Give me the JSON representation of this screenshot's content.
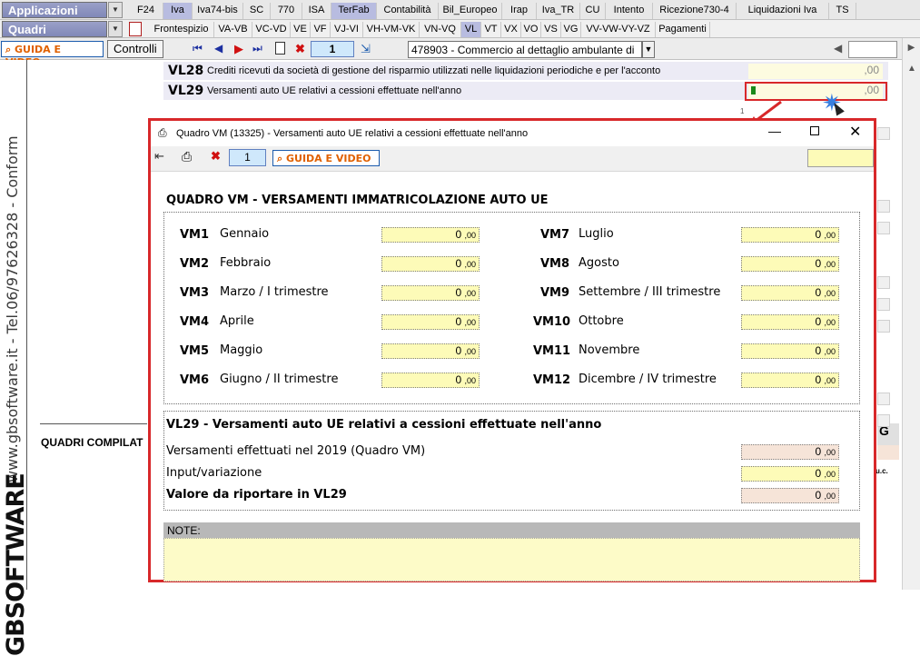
{
  "top": {
    "applicazioni": "Applicazioni",
    "quadri": "Quadri",
    "tabs": [
      "F24",
      "Iva",
      "Iva74-bis",
      "SC",
      "770",
      "ISA",
      "TerFab",
      "Contabilità",
      "Bil_Europeo",
      "Irap",
      "Iva_TR",
      "CU",
      "Intento",
      "Ricezione730-4",
      "Liquidazioni Iva",
      "TS"
    ],
    "subtabs": [
      "Frontespizio",
      "VA-VB",
      "VC-VD",
      "VE",
      "VF",
      "VJ-VI",
      "VH-VM-VK",
      "VN-VQ",
      "VL",
      "VT",
      "VX",
      "VO",
      "VS",
      "VG",
      "VV-VW-VY-VZ",
      "Pagamenti"
    ]
  },
  "toolbar": {
    "guide_label": "GUIDA E VIDEO",
    "controlli": "Controlli",
    "page_number": "1",
    "attivita": "478903 - Commercio al dettaglio ambulante di"
  },
  "sidebar": {
    "website": "www.gbsoftware.it - Tel.06/97626328 - Conform",
    "logo": "GBSOFTWARE"
  },
  "form": {
    "rows": [
      {
        "code": "VL28",
        "desc": "Crediti ricevuti da società di gestione del risparmio utilizzati nelle liquidazioni periodiche e per l'acconto",
        "value": ",00"
      },
      {
        "code": "VL29",
        "desc": "Versamenti auto UE relativi a cessioni effettuate nell'anno",
        "value": ",00"
      }
    ],
    "footnote": "1",
    "quadri_compilati": "QUADRI COMPILAT",
    "right_g": "G",
    "right_uc": "u.c."
  },
  "dialog": {
    "title": "Quadro VM (13325) - Versamenti auto UE relativi a cessioni effettuate nell'anno",
    "page": "1",
    "guide_label": "GUIDA E VIDEO",
    "heading": "QUADRO VM - VERSAMENTI IMMATRICOLAZIONE AUTO UE",
    "months": [
      {
        "code": "VM1",
        "label": "Gennaio",
        "int": "0",
        "dec": ",00"
      },
      {
        "code": "VM2",
        "label": "Febbraio",
        "int": "0",
        "dec": ",00"
      },
      {
        "code": "VM3",
        "label": "Marzo / I trimestre",
        "int": "0",
        "dec": ",00"
      },
      {
        "code": "VM4",
        "label": "Aprile",
        "int": "0",
        "dec": ",00"
      },
      {
        "code": "VM5",
        "label": "Maggio",
        "int": "0",
        "dec": ",00"
      },
      {
        "code": "VM6",
        "label": "Giugno / II trimestre",
        "int": "0",
        "dec": ",00"
      },
      {
        "code": "VM7",
        "label": "Luglio",
        "int": "0",
        "dec": ",00"
      },
      {
        "code": "VM8",
        "label": "Agosto",
        "int": "0",
        "dec": ",00"
      },
      {
        "code": "VM9",
        "label": "Settembre / III trimestre",
        "int": "0",
        "dec": ",00"
      },
      {
        "code": "VM10",
        "label": "Ottobre",
        "int": "0",
        "dec": ",00"
      },
      {
        "code": "VM11",
        "label": "Novembre",
        "int": "0",
        "dec": ",00"
      },
      {
        "code": "VM12",
        "label": "Dicembre / IV trimestre",
        "int": "0",
        "dec": ",00"
      }
    ],
    "vl29_heading": "VL29 - Versamenti auto UE relativi a cessioni effettuate nell'anno",
    "vl29_rows": [
      {
        "label": "Versamenti effettuati nel 2019 (Quadro VM)",
        "int": "0",
        "dec": ",00"
      },
      {
        "label": "Input/variazione",
        "int": "0",
        "dec": ",00"
      },
      {
        "label": "Valore da riportare in VL29",
        "int": "0",
        "dec": ",00"
      }
    ],
    "note_label": "NOTE:"
  }
}
